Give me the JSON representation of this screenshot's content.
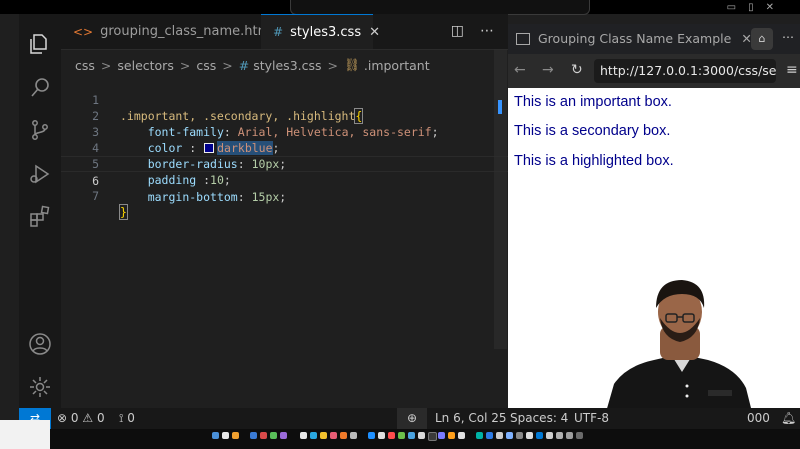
{
  "editor": {
    "tabs": [
      {
        "icon": "html-file-icon",
        "label": "grouping_class_name.html"
      },
      {
        "icon": "css-hash-icon",
        "label": "styles3.css",
        "close": "✕"
      }
    ],
    "breadcrumb": {
      "parts": [
        "css",
        "selectors",
        "css",
        "styles3.css",
        ".important"
      ],
      "separator": ">"
    },
    "code": {
      "line_numbers": [
        "1",
        "2",
        "3",
        "4",
        "5",
        "6",
        "7"
      ],
      "current_line": "6",
      "line1": {
        "selector": ".important, .secondary, .highlight",
        "brace": "{"
      },
      "line2": {
        "prop": "font-family",
        "colon": ":",
        "value": "Arial, Helvetica, sans-serif",
        "end": ";"
      },
      "line3": {
        "prop": "color",
        "colon": " :",
        "value": "darkblue",
        "end": ";"
      },
      "line4": {
        "prop": "border-radius",
        "colon": ":",
        "value": "10px",
        "end": ";"
      },
      "line5": {
        "prop": "padding",
        "colon": " :",
        "value": "10",
        "end": ";"
      },
      "line6": {
        "prop": "margin-bottom",
        "colon": ":",
        "value": "15px",
        "end": ";"
      },
      "line7": {
        "brace": "}"
      }
    }
  },
  "browser": {
    "tab_title": "Grouping Class Name Example",
    "tab_close": "✕",
    "url": "http://127.0.0.1:3000/css/selectors",
    "boxes": [
      "This is an important box.",
      "This is a secondary box.",
      "This is a highlighted box."
    ]
  },
  "status_bar": {
    "errors": "0",
    "warnings": "0",
    "ports": "0",
    "cursor": "Ln 6, Col 25",
    "spaces": "Spaces: 4",
    "encoding": "UTF-8",
    "port_tail": "000"
  },
  "colors": {
    "accent": "#0078d4",
    "page_text": "#00008b",
    "swatch": "#00008b"
  }
}
